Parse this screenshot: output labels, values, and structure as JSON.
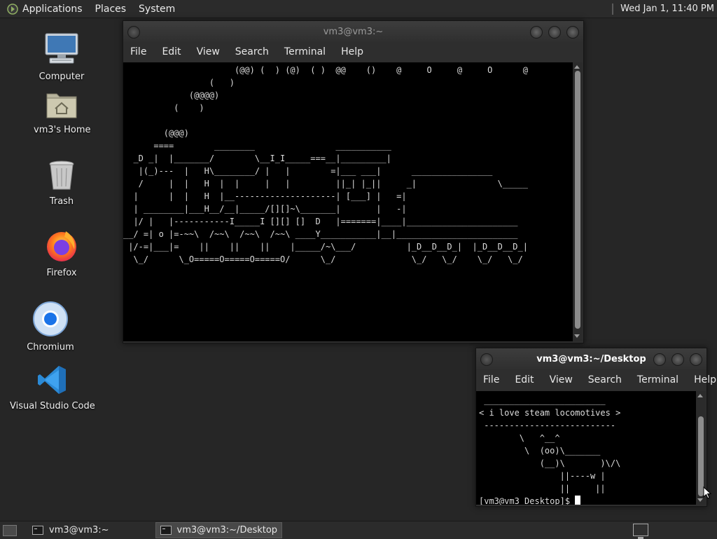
{
  "top_panel": {
    "menus": [
      "Applications",
      "Places",
      "System"
    ],
    "clock": "Wed Jan  1, 11:40 PM"
  },
  "desktop_icons": [
    {
      "label": "Computer",
      "icon": "computer-icon"
    },
    {
      "label": "vm3's Home",
      "icon": "home-folder-icon"
    },
    {
      "label": "Trash",
      "icon": "trash-icon"
    },
    {
      "label": "Firefox",
      "icon": "firefox-icon"
    },
    {
      "label": "Chromium",
      "icon": "chromium-icon"
    },
    {
      "label": "Visual Studio Code",
      "icon": "vscode-icon"
    }
  ],
  "main_window": {
    "title": "vm3@vm3:~",
    "menu": [
      "File",
      "Edit",
      "View",
      "Search",
      "Terminal",
      "Help"
    ],
    "terminal_output": "                      (@@) (  ) (@)  ( )  @@    ()    @     O     @     O      @\n                 (   )\n             (@@@@)\n          (    )\n\n        (@@@)\n      ====        ________                ___________\n  _D _|  |_______/        \\__I_I_____===__|_________|\n   |(_)---  |   H\\________/ |   |        =|___ ___|      ________________\n   /     |  |   H  |  |     |   |         ||_| |_||     _|                \\_____\n  |      |  |   H  |__--------------------| [___] |   =|\n  | ________|___H__/__|_____/[][]~\\_______|       |   -|\n  |/ |   |-----------I_____I [][] []  D   |=======|____|______________________\n__/ =| o |=-~~\\  /~~\\  /~~\\  /~~\\ ____Y___________|__|________________________\n |/-=|___|=    ||    ||    ||    |_____/~\\___/          |_D__D__D_|  |_D__D__D_|\n  \\_/      \\_O=====O=====O=====O/      \\_/               \\_/   \\_/    \\_/   \\_/"
  },
  "desktop_window": {
    "title": "vm3@vm3:~/Desktop",
    "menu": [
      "File",
      "Edit",
      "View",
      "Search",
      "Terminal",
      "Help"
    ],
    "terminal_output": " ________________________\n< i love steam locomotives >\n --------------------------\n        \\   ^__^\n         \\  (oo)\\_______\n            (__)\\       )\\/\\\n                ||----w |\n                ||     ||",
    "prompt": "[vm3@vm3 Desktop]$ "
  },
  "taskbar": {
    "tasks": [
      {
        "label": "vm3@vm3:~",
        "active": false
      },
      {
        "label": "vm3@vm3:~/Desktop",
        "active": true
      }
    ]
  }
}
